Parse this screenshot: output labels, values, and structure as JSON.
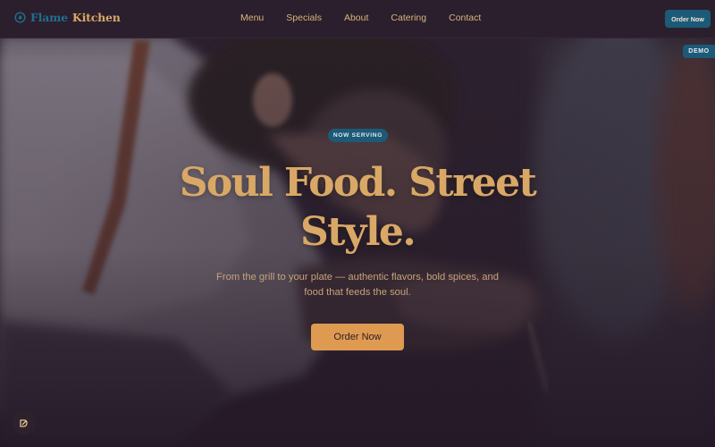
{
  "brand": {
    "name_part1": "Flame",
    "name_part2": "Kitchen",
    "icon": "flame-icon"
  },
  "nav": {
    "links": [
      "Menu",
      "Specials",
      "About",
      "Catering",
      "Contact"
    ],
    "cta_label": "Order Now"
  },
  "demo_badge": "DEMO",
  "hero": {
    "pill": "NOW SERVING",
    "headline_line1": "Soul Food. Street",
    "headline_line2": "Style.",
    "subtext_line1": "From the grill to your plate — authentic flavors, bold spices, and",
    "subtext_line2": "food that feeds the soul.",
    "cta_label": "Order Now"
  },
  "corner_button": {
    "icon": "accessibility-widget-icon"
  },
  "colors": {
    "background": "#2b1f2d",
    "accent_gold": "#d9a866",
    "accent_teal": "#1c5a78",
    "cta_orange": "#df9a52"
  }
}
